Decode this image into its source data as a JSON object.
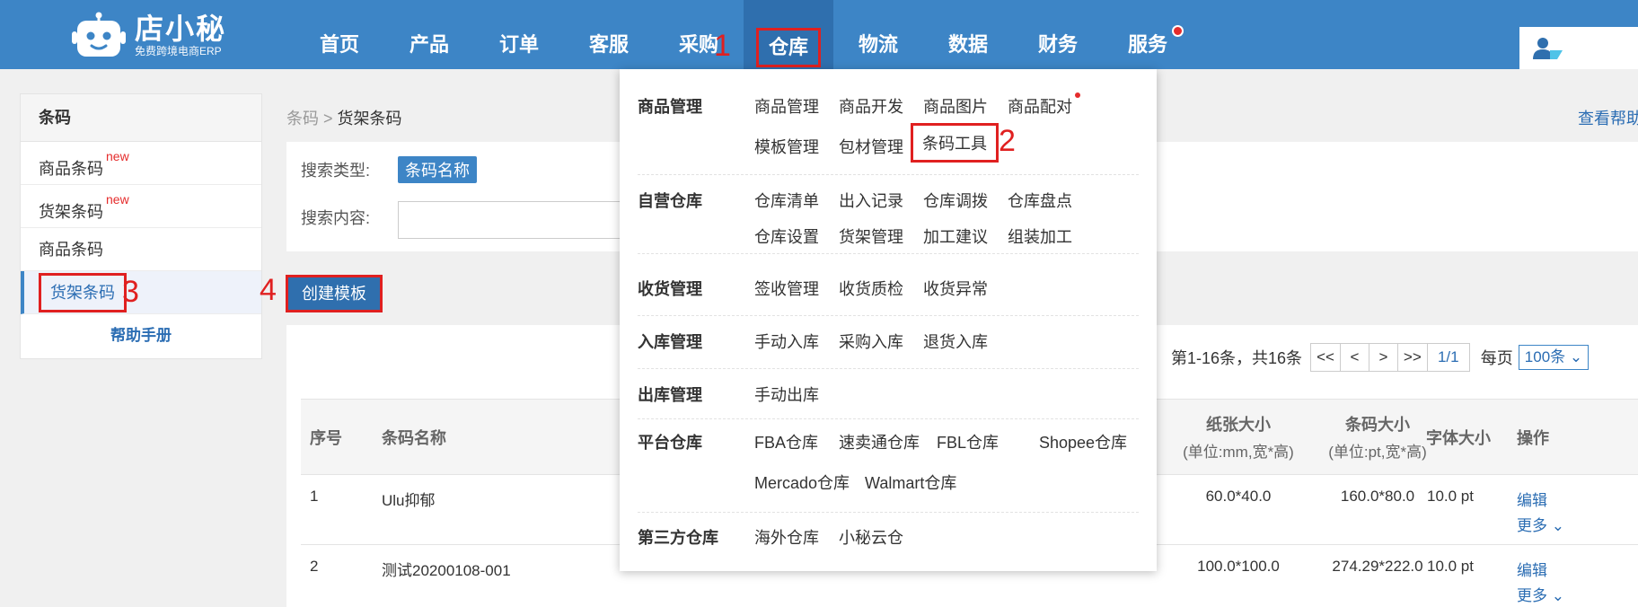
{
  "logo": {
    "title": "店小秘",
    "subtitle": "免费跨境电商ERP"
  },
  "nav": [
    "首页",
    "产品",
    "订单",
    "客服",
    "采购",
    "仓库",
    "物流",
    "数据",
    "财务",
    "服务"
  ],
  "annotations": {
    "a1": "1",
    "a2": "2",
    "a3": "3",
    "a4": "4"
  },
  "sidebar": {
    "title": "条码",
    "items": [
      {
        "label": "商品条码",
        "badge": "new"
      },
      {
        "label": "货架条码",
        "badge": "new"
      },
      {
        "label": "商品条码"
      },
      {
        "label": "货架条码"
      }
    ],
    "help": "帮助手册"
  },
  "breadcrumb": {
    "root": "条码",
    "sep": " > ",
    "current": "货架条码"
  },
  "help_link": "查看帮助",
  "search": {
    "type_label": "搜索类型:",
    "type_value": "条码名称",
    "content_label": "搜索内容:",
    "content_value": ""
  },
  "create_button": "创建模板",
  "pager": {
    "info": "第1-16条，共16条",
    "first": "<<",
    "prev": "<",
    "next": ">",
    "last": ">>",
    "page": "1/1",
    "per_label": "每页",
    "per_value": "100条"
  },
  "table": {
    "headers": {
      "index": "序号",
      "name": "条码名称",
      "paper_size": "纸张大小",
      "paper_unit": "(单位:mm,宽*高)",
      "barcode_size": "条码大小",
      "barcode_unit": "(单位:pt,宽*高)",
      "font_size": "字体大小",
      "action": "操作"
    },
    "rows": [
      {
        "index": "1",
        "name": "Ulu抑郁",
        "paper": "60.0*40.0",
        "barcode": "160.0*80.0",
        "font": "10.0 pt",
        "edit": "编辑",
        "more": "更多"
      },
      {
        "index": "2",
        "name": "测试20200108-001",
        "paper": "100.0*100.0",
        "barcode": "274.29*222.0",
        "font": "10.0 pt",
        "edit": "编辑",
        "more": "更多"
      }
    ]
  },
  "menu": {
    "groups": [
      {
        "name": "商品管理",
        "items": [
          "商品管理",
          "商品开发",
          "商品图片",
          "商品配对",
          "模板管理",
          "包材管理",
          "条码工具"
        ]
      },
      {
        "name": "自营仓库",
        "items": [
          "仓库清单",
          "出入记录",
          "仓库调拨",
          "仓库盘点",
          "仓库设置",
          "货架管理",
          "加工建议",
          "组装加工"
        ]
      },
      {
        "name": "收货管理",
        "items": [
          "签收管理",
          "收货质检",
          "收货异常"
        ]
      },
      {
        "name": "入库管理",
        "items": [
          "手动入库",
          "采购入库",
          "退货入库"
        ]
      },
      {
        "name": "出库管理",
        "items": [
          "手动出库"
        ]
      },
      {
        "name": "平台仓库",
        "items": [
          "FBA仓库",
          "速卖通仓库",
          "FBL仓库",
          "Shopee仓库",
          "Mercado仓库",
          "Walmart仓库"
        ]
      },
      {
        "name": "第三方仓库",
        "items": [
          "海外仓库",
          "小秘云仓"
        ]
      }
    ]
  },
  "colors": {
    "brand": "#3d85c6",
    "highlight": "#e02020",
    "link": "#2b6db3"
  }
}
